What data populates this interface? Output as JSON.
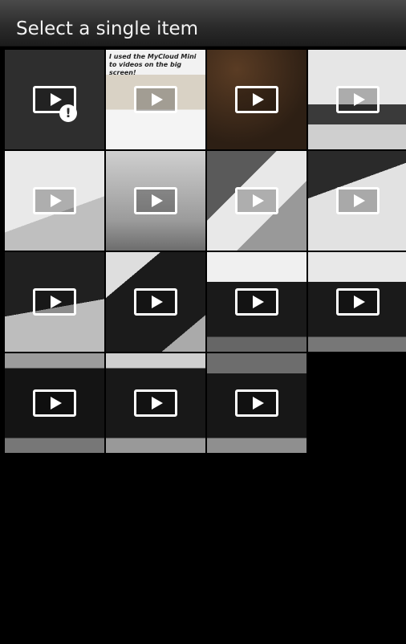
{
  "header": {
    "title": "Select a single item"
  },
  "grid": {
    "items": [
      {
        "thumb": "broken-video",
        "icon": "play-icon",
        "badge": "!"
      },
      {
        "thumb": "sketch",
        "icon": "play-icon",
        "caption": "I used the MyCloud Mini to videos on the big screen!"
      },
      {
        "thumb": "brown",
        "icon": "play-icon"
      },
      {
        "thumb": "monitor",
        "icon": "play-icon"
      },
      {
        "thumb": "notebook",
        "icon": "play-icon"
      },
      {
        "thumb": "grey",
        "icon": "play-icon"
      },
      {
        "thumb": "box",
        "icon": "play-icon"
      },
      {
        "thumb": "keyboard",
        "icon": "play-icon"
      },
      {
        "thumb": "keyboard-2",
        "icon": "play-icon"
      },
      {
        "thumb": "case-1",
        "icon": "play-icon"
      },
      {
        "thumb": "case-2",
        "icon": "play-icon"
      },
      {
        "thumb": "case-3",
        "icon": "play-icon"
      },
      {
        "thumb": "case-4",
        "icon": "play-icon"
      },
      {
        "thumb": "case-5",
        "icon": "play-icon"
      },
      {
        "thumb": "case-6",
        "icon": "play-icon"
      }
    ]
  },
  "colors": {
    "background": "#000000",
    "titlebar": "#2a2a2a",
    "title_text": "#f2f2f2",
    "play_icon": "#ffffff"
  }
}
